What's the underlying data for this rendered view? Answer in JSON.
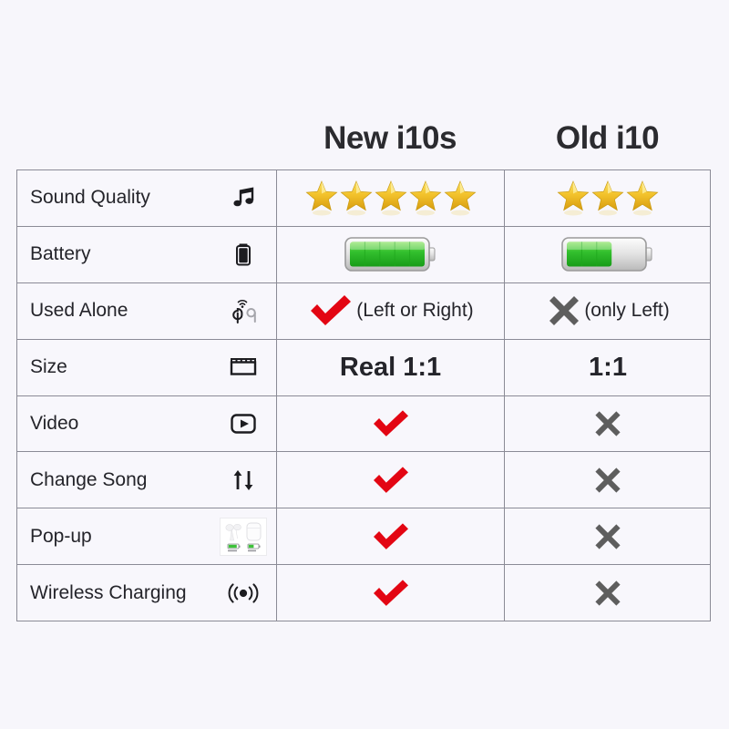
{
  "page": {
    "background_color": "#f7f6fb",
    "border_color": "#8b8b96",
    "cell_background": "#f8f7fc",
    "check_color": "#e30613",
    "cross_color": "#5e5e5e",
    "star_color": "#f2c12e",
    "battery_color": "#35c431"
  },
  "header": {
    "label_column": "",
    "new_product": "New i10s",
    "old_product": "Old i10"
  },
  "table": {
    "rows": [
      {
        "label": "Sound Quality",
        "icon": "music-note-icon",
        "new": {
          "type": "stars",
          "value": 5,
          "max": 5,
          "text": ""
        },
        "old": {
          "type": "stars",
          "value": 3,
          "max": 5,
          "text": ""
        }
      },
      {
        "label": "Battery",
        "icon": "battery-icon",
        "new": {
          "type": "battery",
          "value": 5,
          "max": 5,
          "text": ""
        },
        "old": {
          "type": "battery",
          "value": 3,
          "max": 5,
          "text": ""
        }
      },
      {
        "label": "Used Alone",
        "icon": "earbuds-wireless-icon",
        "new": {
          "type": "check",
          "value": 1,
          "max": 1,
          "text": "(Left or Right)"
        },
        "old": {
          "type": "cross",
          "value": 0,
          "max": 1,
          "text": "(only Left)"
        }
      },
      {
        "label": "Size",
        "icon": "ruler-icon",
        "new": {
          "type": "text",
          "value": 1,
          "max": 1,
          "text": "Real 1:1"
        },
        "old": {
          "type": "text",
          "value": 0,
          "max": 1,
          "text": "1:1"
        }
      },
      {
        "label": "Video",
        "icon": "play-button-icon",
        "new": {
          "type": "check",
          "value": 1,
          "max": 1,
          "text": ""
        },
        "old": {
          "type": "cross",
          "value": 0,
          "max": 1,
          "text": ""
        }
      },
      {
        "label": "Change Song",
        "icon": "up-down-arrows-icon",
        "new": {
          "type": "check",
          "value": 1,
          "max": 1,
          "text": ""
        },
        "old": {
          "type": "cross",
          "value": 0,
          "max": 1,
          "text": ""
        }
      },
      {
        "label": "Pop-up",
        "icon": "earbuds-case-popup-icon",
        "new": {
          "type": "check",
          "value": 1,
          "max": 1,
          "text": ""
        },
        "old": {
          "type": "cross",
          "value": 0,
          "max": 1,
          "text": ""
        }
      },
      {
        "label": "Wireless Charging",
        "icon": "wireless-signal-icon",
        "new": {
          "type": "check",
          "value": 1,
          "max": 1,
          "text": ""
        },
        "old": {
          "type": "cross",
          "value": 0,
          "max": 1,
          "text": ""
        }
      }
    ]
  }
}
